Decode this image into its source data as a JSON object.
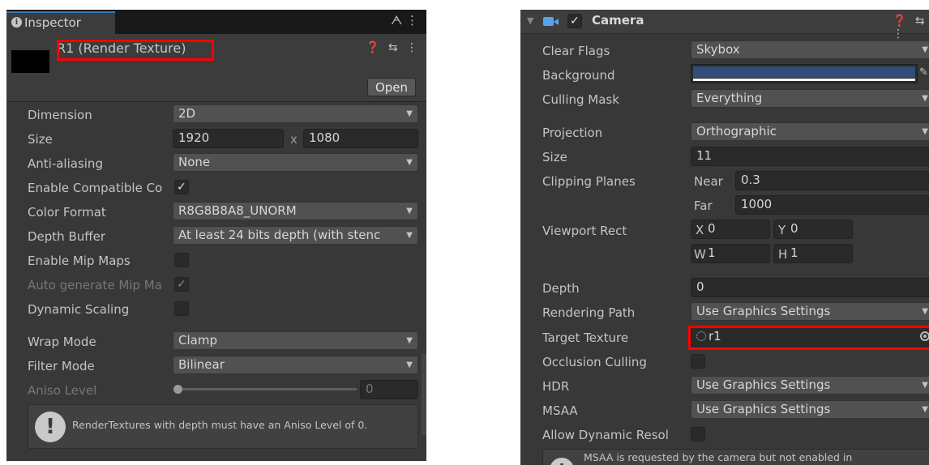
{
  "inspector": {
    "tab_label": "Inspector",
    "tab_icons": "ᗅ  ⋮",
    "asset_title": "R1 (Render Texture)",
    "header_icons": "❓ ⇆ ⋮",
    "open_label": "Open",
    "dimension": {
      "label": "Dimension",
      "value": "2D"
    },
    "size": {
      "label": "Size",
      "width": "1920",
      "x_sep": "x",
      "height": "1080"
    },
    "anti_aliasing": {
      "label": "Anti-aliasing",
      "value": "None"
    },
    "enable_compatible": {
      "label": "Enable Compatible Co",
      "checked": true,
      "mark": "✓"
    },
    "color_format": {
      "label": "Color Format",
      "value": "R8G8B8A8_UNORM"
    },
    "depth_buffer": {
      "label": "Depth Buffer",
      "value": "At least 24 bits depth (with stenc"
    },
    "enable_mip_maps": {
      "label": "Enable Mip Maps",
      "checked": false
    },
    "auto_generate_mip": {
      "label": "Auto generate Mip Ma",
      "checked": true,
      "mark": "✓"
    },
    "dynamic_scaling": {
      "label": "Dynamic Scaling",
      "checked": false
    },
    "wrap_mode": {
      "label": "Wrap Mode",
      "value": "Clamp"
    },
    "filter_mode": {
      "label": "Filter Mode",
      "value": "Bilinear"
    },
    "aniso_level": {
      "label": "Aniso Level",
      "value": "0",
      "level": 0
    },
    "help_message": "RenderTextures with depth must have an Aniso Level of 0.",
    "help_icon": "!"
  },
  "camera": {
    "title": "Camera",
    "enabled_mark": "✓",
    "header_icons": "❓ ⇆ ⋮",
    "clear_flags": {
      "label": "Clear Flags",
      "value": "Skybox"
    },
    "background": {
      "label": "Background",
      "color": "#314d79"
    },
    "culling_mask": {
      "label": "Culling Mask",
      "value": "Everything"
    },
    "projection": {
      "label": "Projection",
      "value": "Orthographic"
    },
    "size": {
      "label": "Size",
      "value": "11"
    },
    "clipping_planes": {
      "label": "Clipping Planes",
      "near_label": "Near",
      "near": "0.3",
      "far_label": "Far",
      "far": "1000"
    },
    "viewport_rect": {
      "label": "Viewport Rect",
      "x_label": "X",
      "x": "0",
      "y_label": "Y",
      "y": "0",
      "w_label": "W",
      "w": "1",
      "h_label": "H",
      "h": "1"
    },
    "depth": {
      "label": "Depth",
      "value": "0"
    },
    "rendering_path": {
      "label": "Rendering Path",
      "value": "Use Graphics Settings"
    },
    "target_texture": {
      "label": "Target Texture",
      "value": "r1"
    },
    "occlusion_culling": {
      "label": "Occlusion Culling",
      "checked": false
    },
    "hdr": {
      "label": "HDR",
      "value": "Use Graphics Settings"
    },
    "msaa": {
      "label": "MSAA",
      "value": "Use Graphics Settings"
    },
    "allow_dynamic": {
      "label": "Allow Dynamic Resol",
      "checked": false
    },
    "msaa_note": "MSAA is requested by the camera but not enabled in"
  },
  "colors": {
    "highlight": "#ff0000",
    "panel_bg": "#383838",
    "accent": "#3a79bb"
  }
}
